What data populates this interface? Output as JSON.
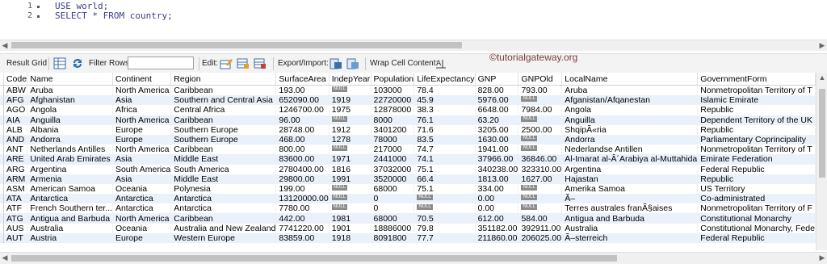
{
  "editor": {
    "lines": [
      {
        "num": "1",
        "code": "USE world;"
      },
      {
        "num": "2",
        "code": "SELECT * FROM country;"
      }
    ]
  },
  "toolbar": {
    "result_grid": "Result Grid",
    "filter_rows": "Filter Rows:",
    "filter_value": "",
    "edit": "Edit:",
    "export_import": "Export/Import:",
    "wrap_cell": "Wrap Cell Content:",
    "watermark": "©tutorialgateway.org"
  },
  "grid": {
    "columns": [
      "Code",
      "Name",
      "Continent",
      "Region",
      "SurfaceArea",
      "IndepYear",
      "Population",
      "LifeExpectancy",
      "GNP",
      "GNPOld",
      "LocalName",
      "GovernmentForm"
    ],
    "null_label": "NULL",
    "rows": [
      [
        "ABW",
        "Aruba",
        "North America",
        "Caribbean",
        "193.00",
        null,
        "103000",
        "78.4",
        "828.00",
        "793.00",
        "Aruba",
        "Nonmetropolitan Territory of T"
      ],
      [
        "AFG",
        "Afghanistan",
        "Asia",
        "Southern and Central Asia",
        "652090.00",
        "1919",
        "22720000",
        "45.9",
        "5976.00",
        null,
        "Afganistan/Afqanestan",
        "Islamic Emirate"
      ],
      [
        "AGO",
        "Angola",
        "Africa",
        "Central Africa",
        "1246700.00",
        "1975",
        "12878000",
        "38.3",
        "6648.00",
        "7984.00",
        "Angola",
        "Republic"
      ],
      [
        "AIA",
        "Anguilla",
        "North America",
        "Caribbean",
        "96.00",
        null,
        "8000",
        "76.1",
        "63.20",
        null,
        "Anguilla",
        "Dependent Territory of the UK"
      ],
      [
        "ALB",
        "Albania",
        "Europe",
        "Southern Europe",
        "28748.00",
        "1912",
        "3401200",
        "71.6",
        "3205.00",
        "2500.00",
        "ShqipÃ«ria",
        "Republic"
      ],
      [
        "AND",
        "Andorra",
        "Europe",
        "Southern Europe",
        "468.00",
        "1278",
        "78000",
        "83.5",
        "1630.00",
        null,
        "Andorra",
        "Parliamentary Coprincipality"
      ],
      [
        "ANT",
        "Netherlands Antilles",
        "North America",
        "Caribbean",
        "800.00",
        null,
        "217000",
        "74.7",
        "1941.00",
        null,
        "Nederlandse Antillen",
        "Nonmetropolitan Territory of T"
      ],
      [
        "ARE",
        "United Arab Emirates",
        "Asia",
        "Middle East",
        "83600.00",
        "1971",
        "2441000",
        "74.1",
        "37966.00",
        "36846.00",
        "Al-Imarat al-Â´Arabiya al-Muttahida",
        "Emirate Federation"
      ],
      [
        "ARG",
        "Argentina",
        "South America",
        "South America",
        "2780400.00",
        "1816",
        "37032000",
        "75.1",
        "340238.00",
        "323310.00",
        "Argentina",
        "Federal Republic"
      ],
      [
        "ARM",
        "Armenia",
        "Asia",
        "Middle East",
        "29800.00",
        "1991",
        "3520000",
        "66.4",
        "1813.00",
        "1627.00",
        "Hajastan",
        "Republic"
      ],
      [
        "ASM",
        "American Samoa",
        "Oceania",
        "Polynesia",
        "199.00",
        null,
        "68000",
        "75.1",
        "334.00",
        null,
        "Amerika Samoa",
        "US Territory"
      ],
      [
        "ATA",
        "Antarctica",
        "Antarctica",
        "Antarctica",
        "13120000.00",
        null,
        "0",
        null,
        "0.00",
        null,
        "Ã–",
        "Co-administrated"
      ],
      [
        "ATF",
        "French Southern ter...",
        "Antarctica",
        "Antarctica",
        "7780.00",
        null,
        "0",
        null,
        "0.00",
        null,
        "Terres australes franÃ§aises",
        "Nonmetropolitan Territory of F"
      ],
      [
        "ATG",
        "Antigua and Barbuda",
        "North America",
        "Caribbean",
        "442.00",
        "1981",
        "68000",
        "70.5",
        "612.00",
        "584.00",
        "Antigua and Barbuda",
        "Constitutional Monarchy"
      ],
      [
        "AUS",
        "Australia",
        "Oceania",
        "Australia and New Zealand",
        "7741220.00",
        "1901",
        "18886000",
        "79.8",
        "351182.00",
        "392911.00",
        "Australia",
        "Constitutional Monarchy, Fede"
      ],
      [
        "AUT",
        "Austria",
        "Europe",
        "Western Europe",
        "83859.00",
        "1918",
        "8091800",
        "77.7",
        "211860.00",
        "206025.00",
        "Ã–sterreich",
        "Federal Republic"
      ]
    ]
  }
}
